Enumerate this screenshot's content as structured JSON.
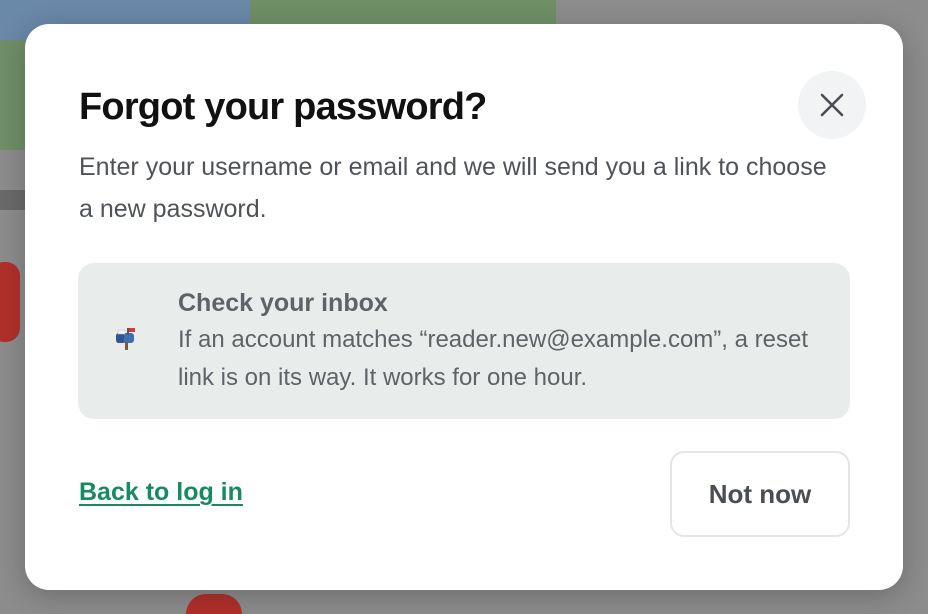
{
  "dialog": {
    "title": "Forgot your password?",
    "description": "Enter your username or email and we will send you a link to choose a new password.",
    "close_icon": "close-icon",
    "notice": {
      "icon": "mailbox-icon",
      "icon_glyph": "📬",
      "title": "Check your inbox",
      "body": "If an account matches “reader.new@example.com”, a reset link is on its way. It works for one hour."
    },
    "back_link_label": "Back to log in",
    "not_now_label": "Not now"
  },
  "colors": {
    "link": "#178a5f",
    "notice_background": "#e8edec",
    "title": "#111111",
    "text": "#4f5359"
  }
}
